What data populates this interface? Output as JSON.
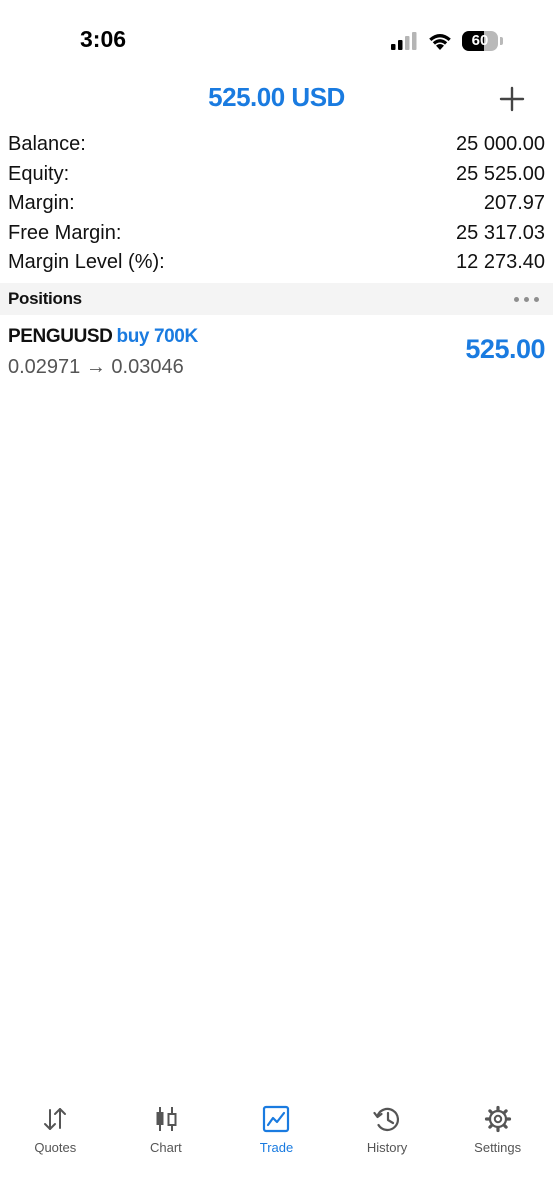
{
  "status_bar": {
    "time": "3:06",
    "battery_level": "60",
    "battery_fraction": 0.6,
    "icons": [
      "cellular-signal-icon",
      "wifi-icon",
      "battery-icon"
    ]
  },
  "header": {
    "title": "525.00 USD",
    "add_icon": "plus-icon"
  },
  "summary": [
    {
      "label": "Balance:",
      "value": "25 000.00"
    },
    {
      "label": "Equity:",
      "value": "25 525.00"
    },
    {
      "label": "Margin:",
      "value": "207.97"
    },
    {
      "label": "Free Margin:",
      "value": "25 317.03"
    },
    {
      "label": "Margin Level (%):",
      "value": "12 273.40"
    }
  ],
  "positions": {
    "title": "Positions",
    "more_icon": "more-horizontal-icon",
    "items": [
      {
        "symbol": "PENGUUSD",
        "side": "buy 700K",
        "prices": "0.02971 → 0.03046",
        "profit": "525.00"
      }
    ]
  },
  "tabs": [
    {
      "label": "Quotes",
      "icon": "quotes-arrows-icon",
      "active": false
    },
    {
      "label": "Chart",
      "icon": "candlestick-chart-icon",
      "active": false
    },
    {
      "label": "Trade",
      "icon": "trade-chart-icon",
      "active": true
    },
    {
      "label": "History",
      "icon": "history-clock-icon",
      "active": false
    },
    {
      "label": "Settings",
      "icon": "gear-icon",
      "active": false
    }
  ],
  "colors": {
    "accent": "#1a7be0",
    "text": "#111111",
    "secondary_text": "#555555",
    "section_bg": "#f4f4f4"
  }
}
